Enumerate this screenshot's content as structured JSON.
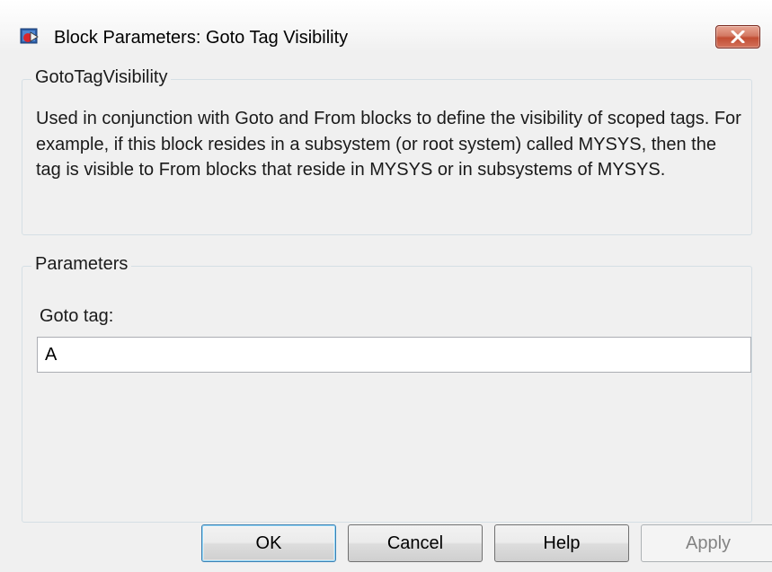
{
  "window": {
    "title": "Block Parameters: Goto Tag Visibility",
    "icon": "simulink-block-icon",
    "close_icon": "close-icon"
  },
  "block_group": {
    "legend": "GotoTagVisibility",
    "description": "Used in conjunction with Goto and From blocks to define the visibility of scoped tags.  For example, if this block resides in a subsystem (or root system) called MYSYS, then the tag is visible to From blocks that reside in MYSYS or in subsystems of MYSYS."
  },
  "parameters_group": {
    "legend": "Parameters",
    "goto_tag_label": "Goto tag:",
    "goto_tag_value": "A"
  },
  "buttons": {
    "ok": "OK",
    "cancel": "Cancel",
    "help": "Help",
    "apply": "Apply"
  },
  "colors": {
    "close_button": "#c24d33",
    "default_button_border": "#3c7fb1",
    "disabled_text": "#838383"
  }
}
